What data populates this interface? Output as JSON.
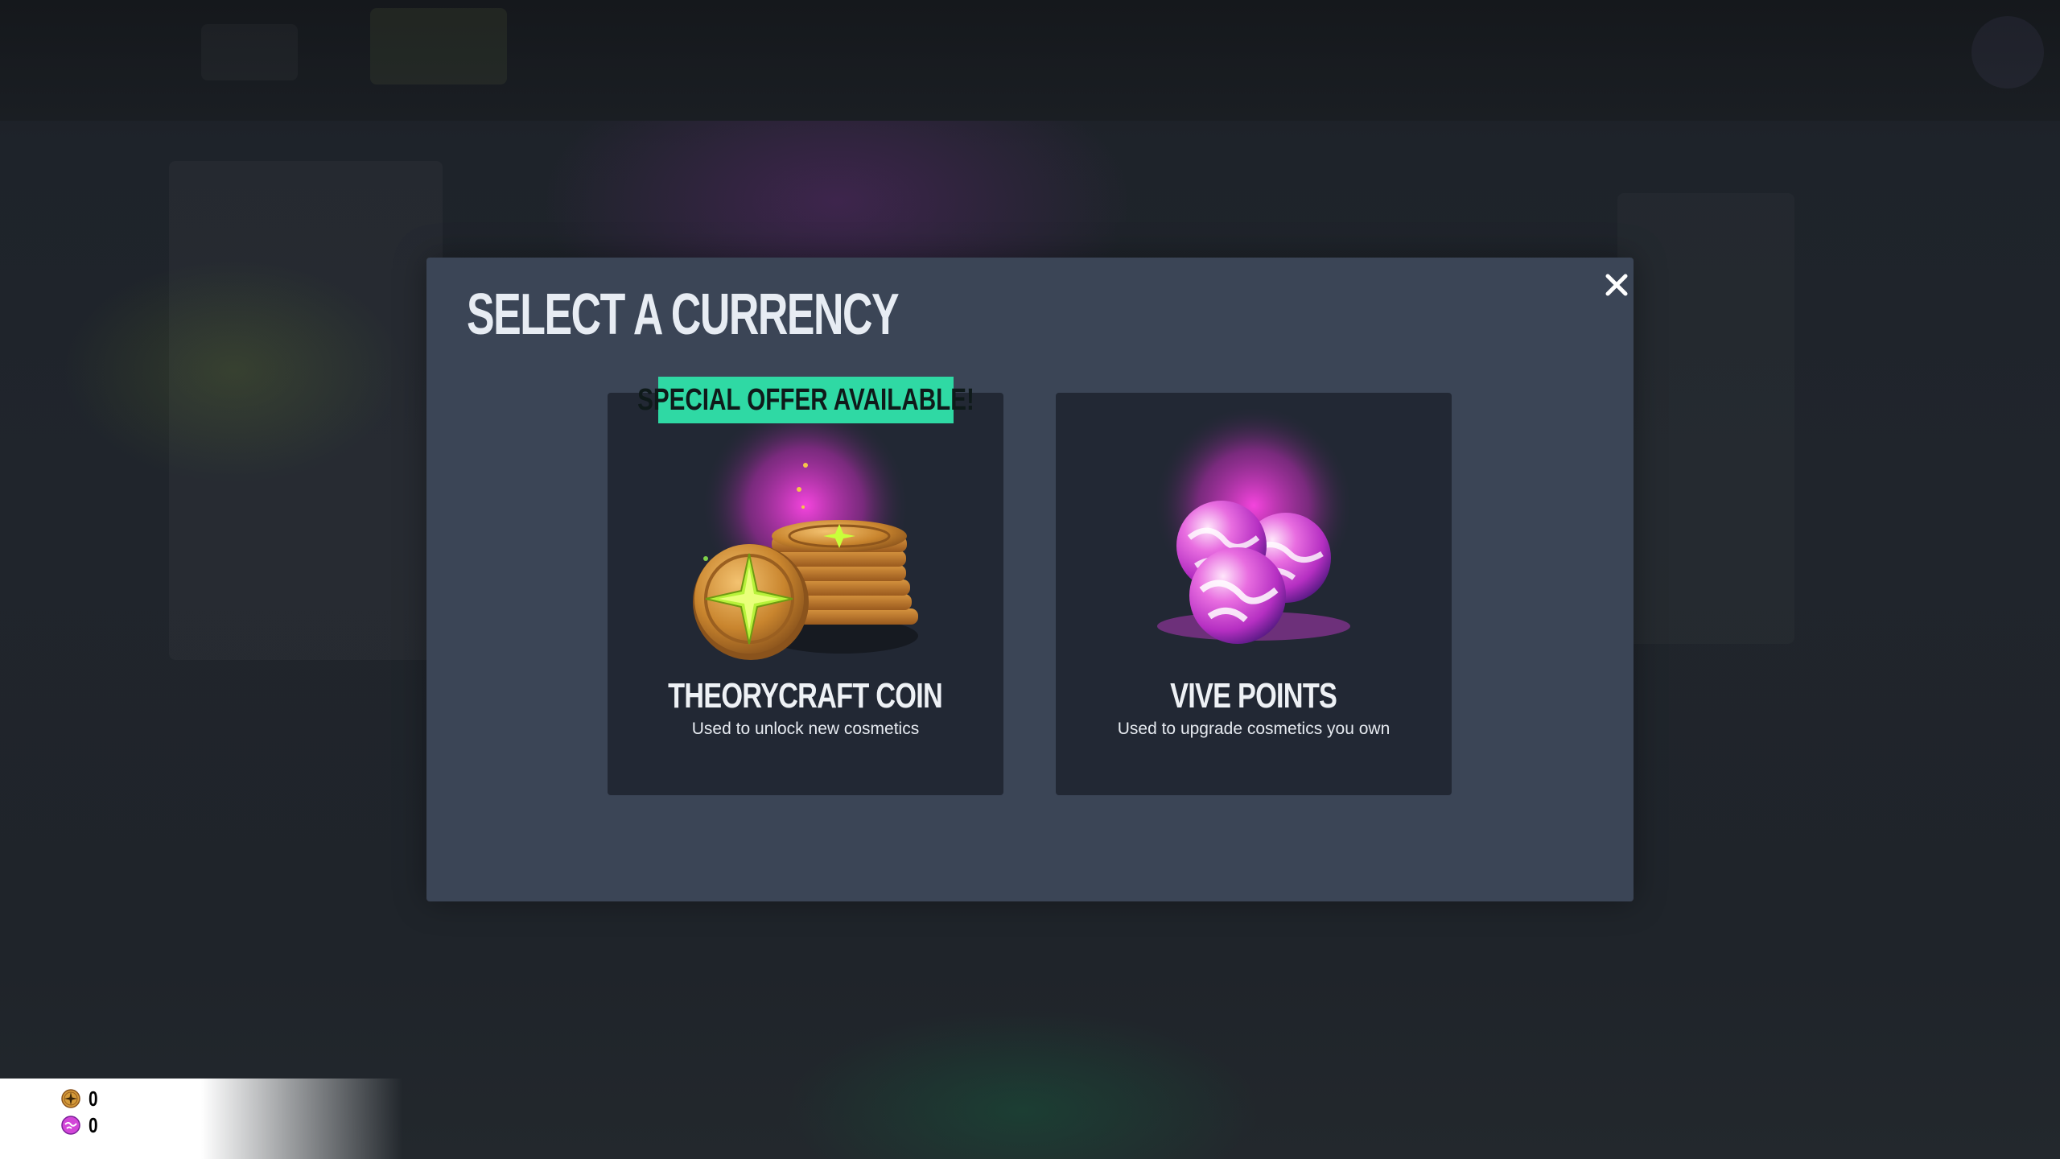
{
  "modal": {
    "title": "SELECT A CURRENCY",
    "close_icon": "close-icon"
  },
  "cards": [
    {
      "badge": "SPECIAL OFFER AVAILABLE!",
      "title": "THEORYCRAFT COIN",
      "description": "Used to unlock new cosmetics",
      "icon": "theorycraft-coin-stack-icon"
    },
    {
      "title": "VIVE POINTS",
      "description": "Used to upgrade cosmetics you own",
      "icon": "vive-points-orbs-icon"
    }
  ],
  "wallet": {
    "coin_amount": "0",
    "coin_icon": "theorycraft-coin-icon",
    "vive_amount": "0",
    "vive_icon": "vive-points-icon"
  },
  "colors": {
    "modal_bg": "#3b4556",
    "card_bg": "#222834",
    "badge_bg": "#2fd9a4",
    "accent_magenta": "#e53fd2",
    "coin_gold": "#d49a3a"
  }
}
